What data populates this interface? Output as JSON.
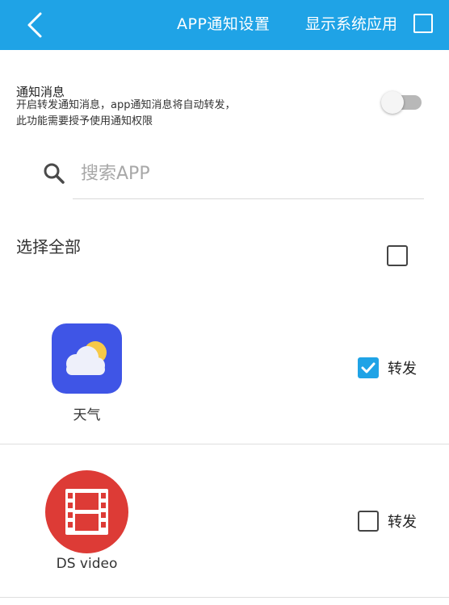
{
  "header": {
    "title": "APP通知设置",
    "show_system_label": "显示系统应用",
    "show_system_checked": false,
    "bg_color": "#1fa3e6"
  },
  "notification": {
    "title": "通知消息",
    "desc_line1": "开启转发通知消息，app通知消息将自动转发，",
    "desc_line2": "此功能需要授予使用通知权限",
    "enabled": false
  },
  "search": {
    "placeholder": "搜索APP",
    "value": ""
  },
  "select_all": {
    "label": "选择全部",
    "checked": false
  },
  "apps": [
    {
      "name": "天气",
      "icon": "weather-icon",
      "forward_label": "转发",
      "checked": true
    },
    {
      "name": "DS video",
      "icon": "film-icon",
      "forward_label": "转发",
      "checked": false
    }
  ]
}
